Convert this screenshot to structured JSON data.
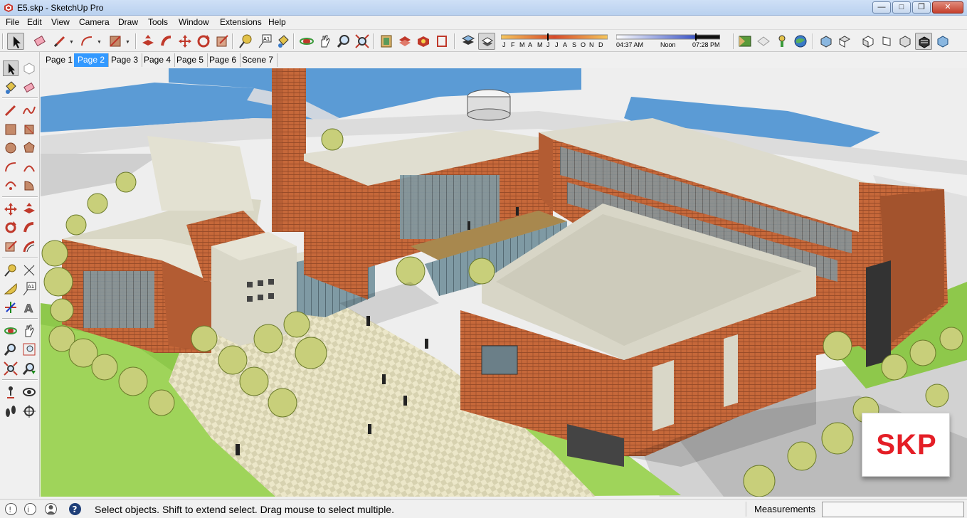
{
  "window": {
    "title": "E5.skp - SketchUp Pro",
    "controls": {
      "minimize": "—",
      "maximize": "□",
      "restore": "❐",
      "close": "✕"
    }
  },
  "menu": [
    "File",
    "Edit",
    "View",
    "Camera",
    "Draw",
    "Tools",
    "Window",
    "Extensions",
    "Help"
  ],
  "shadow_settings": {
    "months": [
      "J",
      "F",
      "M",
      "A",
      "M",
      "J",
      "J",
      "A",
      "S",
      "O",
      "N",
      "D"
    ],
    "time_start": "04:37 AM",
    "time_mid": "Noon",
    "time_end": "07:28 PM"
  },
  "scene_tabs": [
    {
      "label": "Page 1",
      "active": false
    },
    {
      "label": "Page 2",
      "active": true
    },
    {
      "label": "Page 3",
      "active": false
    },
    {
      "label": "Page 4",
      "active": false
    },
    {
      "label": "Page 5",
      "active": false
    },
    {
      "label": "Page 6",
      "active": false
    },
    {
      "label": "Scene 7",
      "active": false
    }
  ],
  "toolbar_icons": [
    "select-icon",
    "eraser-icon",
    "pencil-icon",
    "arc-icon",
    "rectangle-icon",
    "push-pull-icon",
    "follow-me-icon",
    "move-icon",
    "rotate-icon",
    "scale-icon",
    "tape-measure-icon",
    "text-icon",
    "paint-bucket-icon",
    "orbit-icon",
    "pan-icon",
    "zoom-icon",
    "zoom-extents-icon",
    "warehouse-icon",
    "components-icon",
    "extension-icon",
    "section-plane-icon",
    "shadows-icon",
    "fog-icon",
    "views-icon",
    "styles-icon",
    "sandbox-icon",
    "geolocation-icon",
    "iso-view-icon",
    "top-view-icon",
    "front-view-icon",
    "right-view-icon",
    "back-view-icon",
    "left-view-icon"
  ],
  "logo": {
    "text": "SKP",
    "color": "#e41e26"
  },
  "status": {
    "message": "Select objects. Shift to extend select. Drag mouse to select multiple.",
    "measurements_label": "Measurements",
    "measurements_value": ""
  }
}
